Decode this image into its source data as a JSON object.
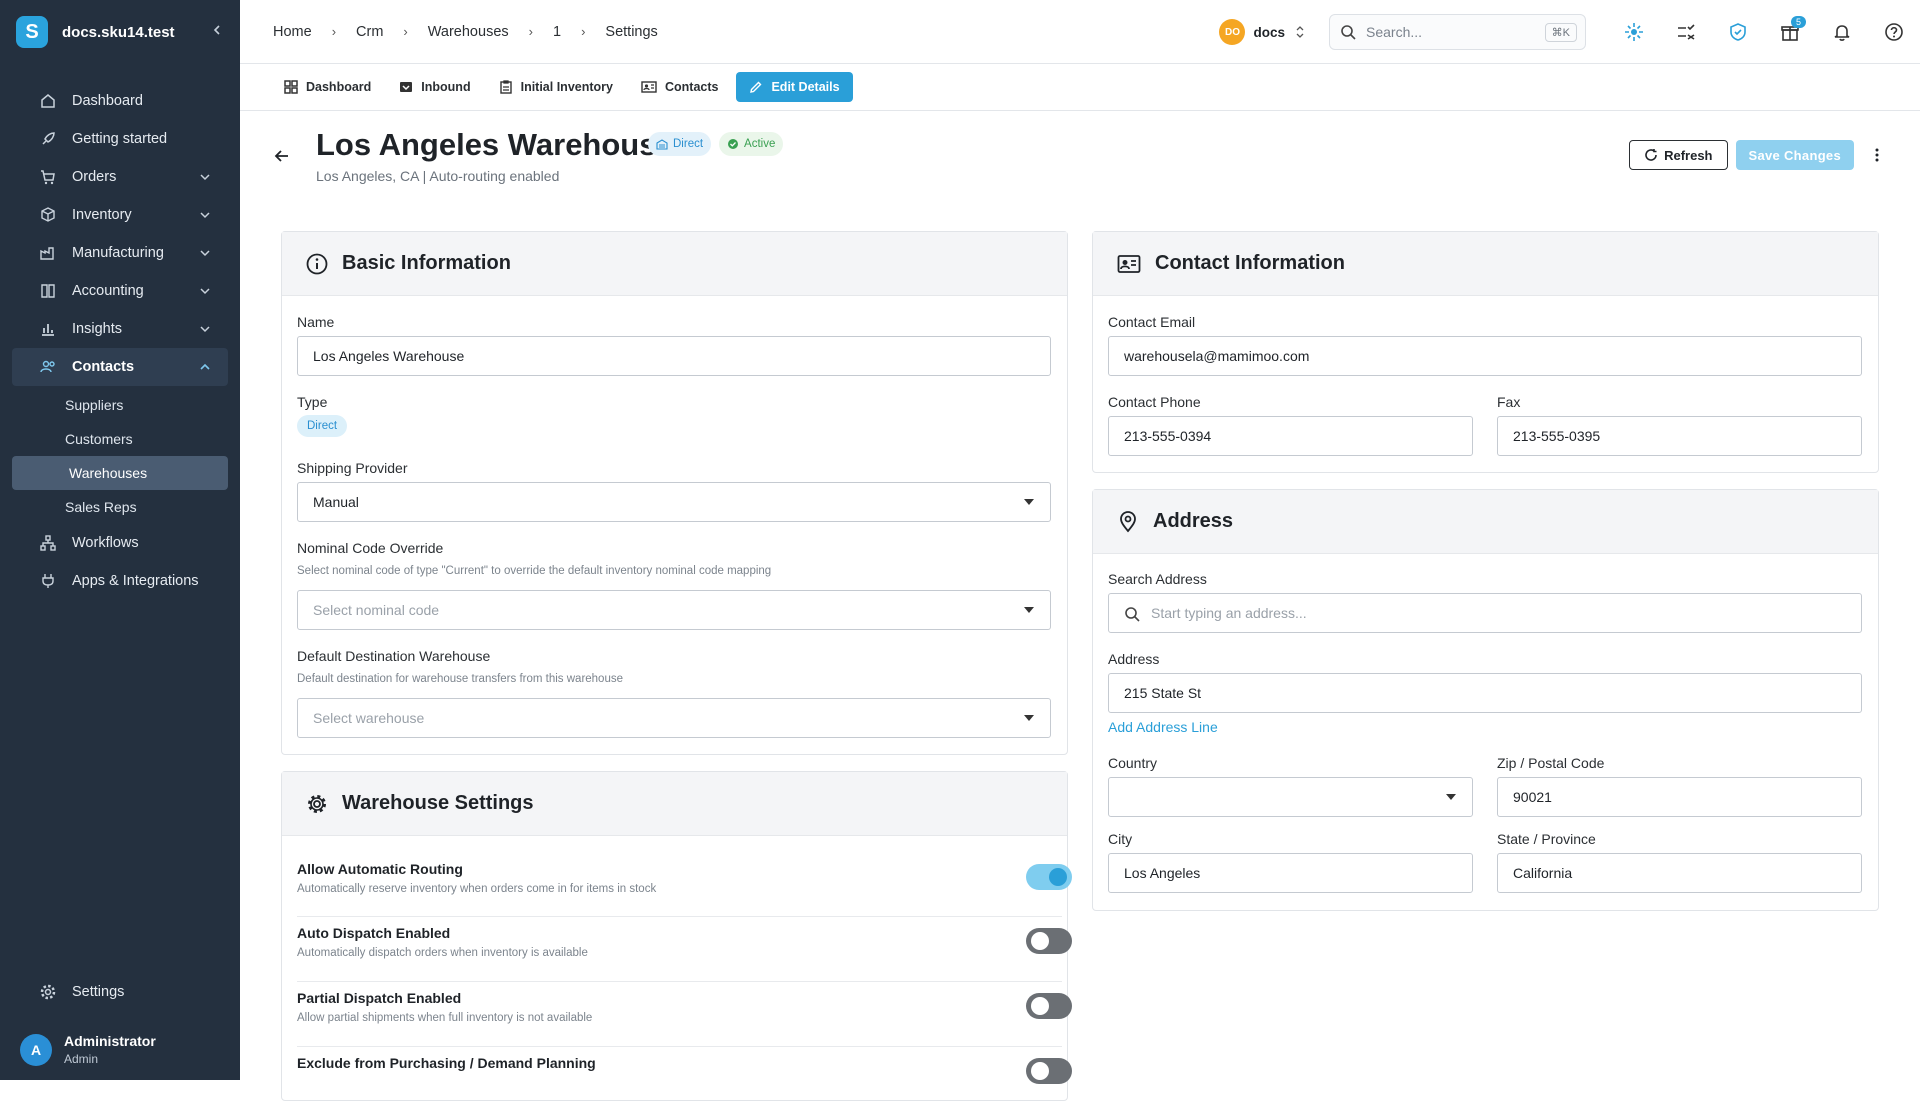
{
  "app": {
    "workspace_title": "docs.sku14.test",
    "logo_letter": "S"
  },
  "sidebar": {
    "items": [
      {
        "label": "Dashboard",
        "icon": "home-icon"
      },
      {
        "label": "Getting started",
        "icon": "rocket-icon"
      },
      {
        "label": "Orders",
        "icon": "cart-icon"
      },
      {
        "label": "Inventory",
        "icon": "box-icon"
      },
      {
        "label": "Manufacturing",
        "icon": "factory-icon"
      },
      {
        "label": "Accounting",
        "icon": "book-icon"
      },
      {
        "label": "Insights",
        "icon": "chart-icon"
      },
      {
        "label": "Contacts",
        "icon": "users-icon"
      }
    ],
    "contacts_sub": [
      "Suppliers",
      "Customers",
      "Warehouses",
      "Sales Reps"
    ],
    "items2": [
      {
        "label": "Workflows",
        "icon": "workflow-icon"
      },
      {
        "label": "Apps & Integrations",
        "icon": "plug-icon"
      }
    ],
    "settings_label": "Settings",
    "user": {
      "initial": "A",
      "name": "Administrator",
      "role": "Admin"
    }
  },
  "topbar": {
    "breadcrumb": [
      "Home",
      "Crm",
      "Warehouses",
      "1",
      "Settings"
    ],
    "workspace_initials": "DO",
    "workspace_name": "docs",
    "search_placeholder": "Search...",
    "search_shortcut": "⌘K",
    "gift_badge": "5"
  },
  "tabs": [
    {
      "label": "Dashboard",
      "icon": "grid-icon",
      "active": false
    },
    {
      "label": "Inbound",
      "icon": "inbox-icon",
      "active": false
    },
    {
      "label": "Initial Inventory",
      "icon": "clipboard-icon",
      "active": false
    },
    {
      "label": "Contacts",
      "icon": "id-card-icon",
      "active": false
    },
    {
      "label": "Edit Details",
      "icon": "pencil-icon",
      "active": true
    }
  ],
  "header": {
    "title": "Los Angeles Warehouse",
    "type_pill": "Direct",
    "status_pill": "Active",
    "subtitle": "Los Angeles, CA | Auto-routing enabled",
    "refresh_label": "Refresh",
    "save_label": "Save Changes"
  },
  "basic": {
    "title": "Basic Information",
    "name_label": "Name",
    "name_value": "Los Angeles Warehouse",
    "type_label": "Type",
    "type_value": "Direct",
    "shipping_label": "Shipping Provider",
    "shipping_value": "Manual",
    "nominal_label": "Nominal Code Override",
    "nominal_hint": "Select nominal code of type \"Current\" to override the default inventory nominal code mapping",
    "nominal_placeholder": "Select nominal code",
    "dest_label": "Default Destination Warehouse",
    "dest_hint": "Default destination for warehouse transfers from this warehouse",
    "dest_placeholder": "Select warehouse"
  },
  "settings": {
    "title": "Warehouse Settings",
    "rows": [
      {
        "title": "Allow Automatic Routing",
        "desc": "Automatically reserve inventory when orders come in for items in stock",
        "on": true
      },
      {
        "title": "Auto Dispatch Enabled",
        "desc": "Automatically dispatch orders when inventory is available",
        "on": false
      },
      {
        "title": "Partial Dispatch Enabled",
        "desc": "Allow partial shipments when full inventory is not available",
        "on": false
      },
      {
        "title": "Exclude from Purchasing / Demand Planning",
        "desc": "",
        "on": false
      }
    ]
  },
  "contact": {
    "title": "Contact Information",
    "email_label": "Contact Email",
    "email_value": "warehousela@mamimoo.com",
    "phone_label": "Contact Phone",
    "phone_value": "213-555-0394",
    "fax_label": "Fax",
    "fax_value": "213-555-0395"
  },
  "address": {
    "title": "Address",
    "search_label": "Search Address",
    "search_placeholder": "Start typing an address...",
    "address_label": "Address",
    "address_value": "215 State St",
    "add_line": "Add Address Line",
    "country_label": "Country",
    "country_value": "",
    "zip_label": "Zip / Postal Code",
    "zip_value": "90021",
    "city_label": "City",
    "city_value": "Los Angeles",
    "state_label": "State / Province",
    "state_value": "California"
  },
  "colors": {
    "accent": "#2a9fd8",
    "sidebar_bg": "#24303f",
    "save_disabled": "#8fd0ef"
  }
}
